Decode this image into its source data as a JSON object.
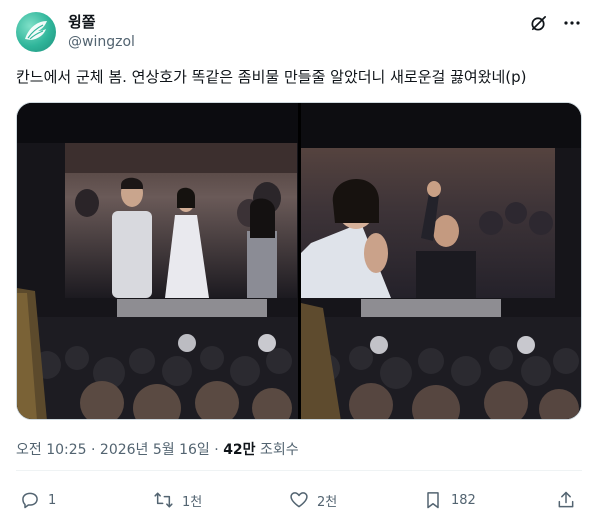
{
  "author": {
    "name": "윙쫄",
    "handle": "@wingzol"
  },
  "header_icons": [
    "grok-icon",
    "more-icon"
  ],
  "tweet": {
    "text": "칸느에서 군체 봄. 연상호가 똑같은 좀비물 만들줄 알았더니 새로운걸 끓여왔네(p)"
  },
  "meta": {
    "time": "오전 10:25",
    "separator1": " · ",
    "date": "2026년 5월 16일",
    "separator2": " · ",
    "views_count": "42만",
    "views_label": " 조회수"
  },
  "actions": {
    "reply_count": "1",
    "retweet_count": "1천",
    "like_count": "2천",
    "bookmark_count": "182"
  },
  "colors": {
    "text": "#0f1419",
    "secondary": "#536471",
    "border": "#cfd9de"
  }
}
